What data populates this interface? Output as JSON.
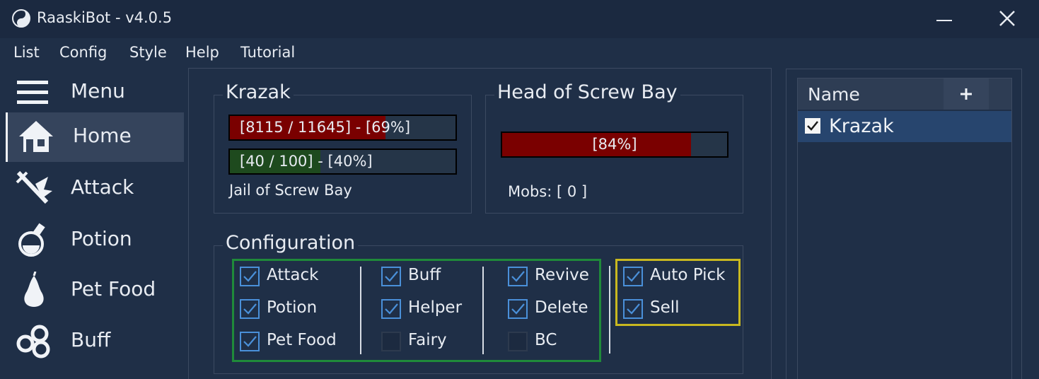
{
  "window": {
    "title": "RaaskiBot - v4.0.5",
    "icon": "yin-yang-icon"
  },
  "menu": [
    "List",
    "Config",
    "Style",
    "Help",
    "Tutorial"
  ],
  "sidebar": {
    "items": [
      {
        "label": "Menu",
        "icon": "hamburger-icon"
      },
      {
        "label": "Home",
        "icon": "house-icon"
      },
      {
        "label": "Attack",
        "icon": "sword-icon"
      },
      {
        "label": "Potion",
        "icon": "potion-flask-icon"
      },
      {
        "label": "Pet Food",
        "icon": "pear-icon"
      },
      {
        "label": "Buff",
        "icon": "swirl-icon"
      }
    ]
  },
  "character": {
    "title": "Krazak",
    "hp_text": "[8115 / 11645] - [69%]",
    "hp_fraction": 0.69,
    "mp_text": "[40 / 100] - [40%]",
    "mp_fraction": 0.4,
    "location": "Jail of Screw Bay"
  },
  "target": {
    "title": "Head of Screw Bay",
    "hp_text": "[84%]",
    "hp_fraction": 0.84,
    "mobs_text": "Mobs:  [ 0 ]"
  },
  "configuration": {
    "title": "Configuration",
    "columns": [
      [
        {
          "label": "Attack",
          "checked": true
        },
        {
          "label": "Potion",
          "checked": true
        },
        {
          "label": "Pet Food",
          "checked": true
        }
      ],
      [
        {
          "label": "Buff",
          "checked": true
        },
        {
          "label": "Helper",
          "checked": true
        },
        {
          "label": "Fairy",
          "checked": false
        }
      ],
      [
        {
          "label": "Revive",
          "checked": true
        },
        {
          "label": "Delete",
          "checked": true
        },
        {
          "label": "BC",
          "checked": false
        }
      ]
    ],
    "extra": [
      {
        "label": "Auto Pick",
        "checked": true
      },
      {
        "label": "Sell",
        "checked": true
      }
    ]
  },
  "list": {
    "header": "Name",
    "add_label": "+",
    "rows": [
      {
        "label": "Krazak",
        "checked": true
      }
    ]
  },
  "colors": {
    "hp": "#7a0000",
    "mp": "#1e4a1e",
    "group_green": "#1f8a3a",
    "group_yellow": "#c8b820",
    "accent": "#4a90d9"
  }
}
